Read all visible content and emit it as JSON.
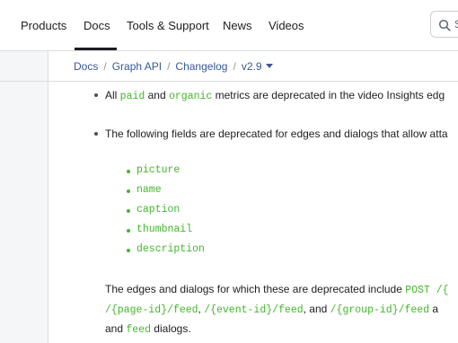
{
  "nav": {
    "items": [
      "Products",
      "Docs",
      "Tools & Support",
      "News",
      "Videos"
    ],
    "active": "Docs",
    "search_placeholder": "S"
  },
  "breadcrumb": {
    "items": [
      "Docs",
      "Graph API",
      "Changelog",
      "v2.9"
    ]
  },
  "content": {
    "bullet1": {
      "pre": "All ",
      "code1": "paid",
      "mid": " and ",
      "code2": "organic",
      "post": " metrics are deprecated in the video Insights edg"
    },
    "bullet2": "The following fields are deprecated for edges and dialogs that allow atta",
    "fields": [
      "picture",
      "name",
      "caption",
      "thumbnail",
      "description"
    ],
    "para": {
      "line1_pre": "The edges and dialogs for which these are deprecated include ",
      "line1_code": "POST /{",
      "line2_code1": "/{page-id}/feed",
      "line2_sep1": ", ",
      "line2_code2": "/{event-id}/feed",
      "line2_sep2": ", and ",
      "line2_code3": "/{group-id}/feed",
      "line2_post": " a",
      "line3_pre": "and ",
      "line3_code": "feed",
      "line3_post": " dialogs."
    }
  }
}
